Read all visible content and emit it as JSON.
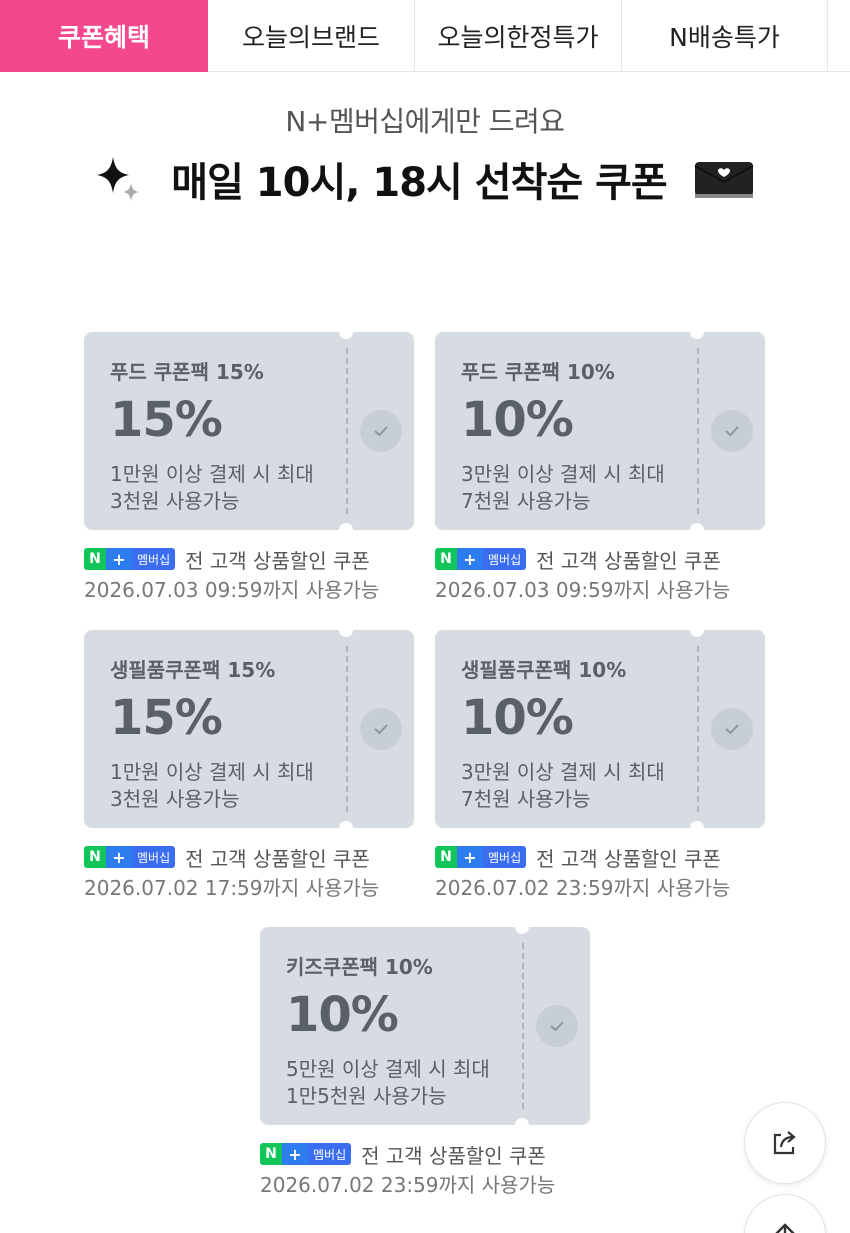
{
  "tabs": [
    {
      "label": "쿠폰혜택",
      "active": true
    },
    {
      "label": "오늘의브랜드",
      "active": false
    },
    {
      "label": "오늘의한정특가",
      "active": false
    },
    {
      "label": "N배송특가",
      "active": false
    }
  ],
  "header": {
    "subtitle": "N+멤버십에게만 드려요",
    "title": "매일 10시, 18시 선착순 쿠폰"
  },
  "badge": {
    "n": "N",
    "plus": "+",
    "label": "멤버십"
  },
  "coupons": [
    {
      "name": "푸드 쿠폰팩 15%",
      "percent": "15%",
      "desc1": "1만원 이상 결제 시 최대",
      "desc2": "3천원 사용가능",
      "target": "전 고객 상품할인 쿠폰",
      "expiry": "2026.07.03 09:59까지 사용가능"
    },
    {
      "name": "푸드 쿠폰팩 10%",
      "percent": "10%",
      "desc1": "3만원 이상 결제 시 최대",
      "desc2": "7천원 사용가능",
      "target": "전 고객 상품할인 쿠폰",
      "expiry": "2026.07.03 09:59까지 사용가능"
    },
    {
      "name": "생필품쿠폰팩 15%",
      "percent": "15%",
      "desc1": "1만원 이상 결제 시 최대",
      "desc2": "3천원 사용가능",
      "target": "전 고객 상품할인 쿠폰",
      "expiry": "2026.07.02 17:59까지 사용가능"
    },
    {
      "name": "생필품쿠폰팩 10%",
      "percent": "10%",
      "desc1": "3만원 이상 결제 시 최대",
      "desc2": "7천원 사용가능",
      "target": "전 고객 상품할인 쿠폰",
      "expiry": "2026.07.02 23:59까지 사용가능"
    },
    {
      "name": "키즈쿠폰팩 10%",
      "percent": "10%",
      "desc1": "5만원 이상 결제 시 최대",
      "desc2": "1만5천원 사용가능",
      "target": "전 고객 상품할인 쿠폰",
      "expiry": "2026.07.02 23:59까지 사용가능"
    }
  ],
  "colors": {
    "accent": "#f5478d",
    "ticket": "#d7dce2",
    "ticket_text": "#5a6069",
    "badge_green": "#12c55a",
    "badge_blue": "#2e7df0"
  },
  "icons": {
    "sparkle": "sparkle-icon",
    "envelope": "envelope-icon",
    "check": "check-icon",
    "share": "share-icon",
    "scroll_top": "arrow-up-icon"
  }
}
